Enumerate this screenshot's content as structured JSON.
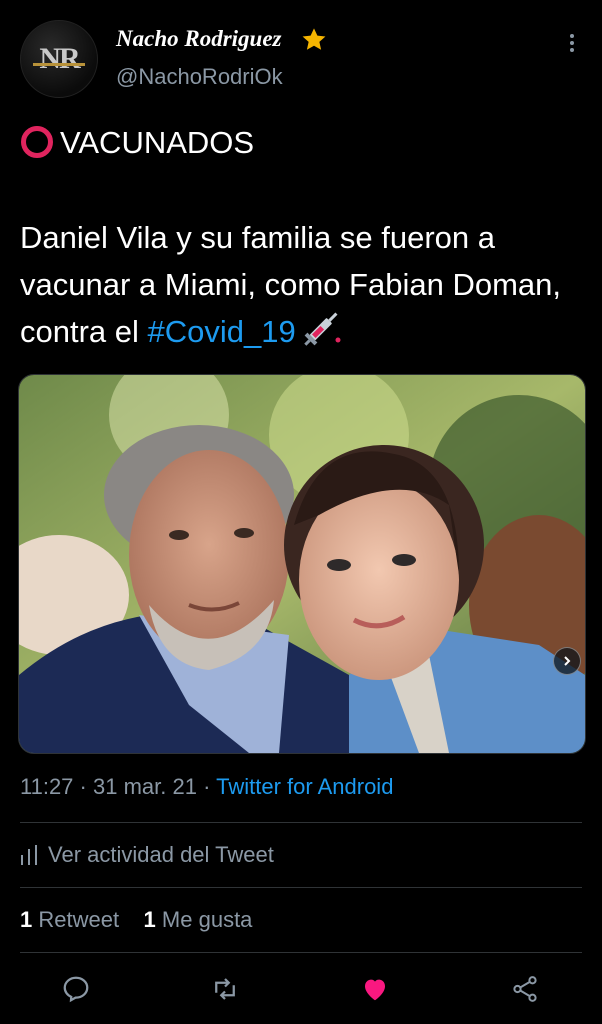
{
  "author": {
    "display_name": "Nacho Rodriguez",
    "handle": "@NachoRodriOk",
    "avatar_monogram": "NR"
  },
  "tweet": {
    "title": "VACUNADOS",
    "body": "Daniel Vila y su familia se fueron a vacunar a Miami, como Fabian Doman, contra el ",
    "hashtag": "#Covid_19",
    "time": "11:27",
    "sep1": "·",
    "date": "31 mar. 21",
    "sep2": "·",
    "source": "Twitter for Android"
  },
  "activity_label": "Ver actividad del Tweet",
  "stats": {
    "retweets_count": "1",
    "retweets_label": "Retweet",
    "likes_count": "1",
    "likes_label": "Me gusta"
  },
  "colors": {
    "background": "#000000",
    "accent": "#1d9bf0",
    "like": "#f91880",
    "star": "#f5b400",
    "circle": "#e0245e"
  },
  "icons": [
    "star-icon",
    "more-icon",
    "red-circle-icon",
    "syringe-icon",
    "chevron-right-icon",
    "activity-icon",
    "reply-icon",
    "retweet-icon",
    "like-icon",
    "share-icon"
  ]
}
